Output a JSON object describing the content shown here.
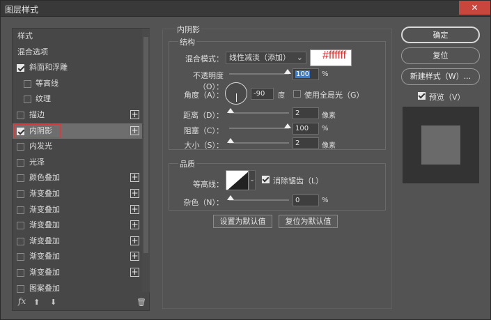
{
  "window": {
    "title": "图层样式",
    "close_glyph": "✕"
  },
  "left_panel": {
    "items": [
      {
        "label": "样式",
        "checkbox": null,
        "plus": false
      },
      {
        "label": "混合选项",
        "checkbox": null,
        "plus": false
      },
      {
        "label": "斜面和浮雕",
        "checkbox": true,
        "plus": false
      },
      {
        "label": "等高线",
        "checkbox": false,
        "plus": false,
        "indent": true
      },
      {
        "label": "纹理",
        "checkbox": false,
        "plus": false,
        "indent": true
      },
      {
        "label": "描边",
        "checkbox": false,
        "plus": true
      },
      {
        "label": "内阴影",
        "checkbox": true,
        "plus": true,
        "selected": true
      },
      {
        "label": "内发光",
        "checkbox": false,
        "plus": false
      },
      {
        "label": "光泽",
        "checkbox": false,
        "plus": false
      },
      {
        "label": "颜色叠加",
        "checkbox": false,
        "plus": true
      },
      {
        "label": "渐变叠加",
        "checkbox": false,
        "plus": true
      },
      {
        "label": "渐变叠加",
        "checkbox": false,
        "plus": true
      },
      {
        "label": "渐变叠加",
        "checkbox": false,
        "plus": true
      },
      {
        "label": "渐变叠加",
        "checkbox": false,
        "plus": true
      },
      {
        "label": "渐变叠加",
        "checkbox": false,
        "plus": true
      },
      {
        "label": "渐变叠加",
        "checkbox": false,
        "plus": true
      },
      {
        "label": "图案叠加",
        "checkbox": false,
        "plus": false
      }
    ],
    "footer": {
      "fx": "fx",
      "up": "⬆",
      "down": "⬇",
      "trash": "🗑"
    }
  },
  "inner_shadow": {
    "section_title": "内阴影",
    "structure": {
      "title": "结构",
      "blend_mode_label": "混合模式：",
      "blend_mode_value": "线性减淡（添加）",
      "color_hex_annotation": "#ffffff",
      "opacity_label": "不透明度（O）：",
      "opacity_value": "100",
      "opacity_unit": "%",
      "angle_label": "角度（A）：",
      "angle_value": "-90",
      "angle_unit": "度",
      "global_light_label": "使用全局光（G）",
      "global_light_checked": false,
      "distance_label": "距离（D）：",
      "distance_value": "2",
      "distance_unit": "像素",
      "choke_label": "阻塞（C）：",
      "choke_value": "100",
      "choke_unit": "%",
      "size_label": "大小（S）：",
      "size_value": "2",
      "size_unit": "像素"
    },
    "quality": {
      "title": "品质",
      "contour_label": "等高线：",
      "antialias_label": "消除锯齿（L）",
      "antialias_checked": true,
      "noise_label": "杂色（N）：",
      "noise_value": "0",
      "noise_unit": "%"
    },
    "buttons": {
      "set_default": "设置为默认值",
      "reset_default": "复位为默认值"
    }
  },
  "right_buttons": {
    "ok": "确定",
    "reset": "复位",
    "new_style": "新建样式（W）...",
    "preview_label": "预览（V）",
    "preview_checked": true
  },
  "colors": {
    "accent_highlight": "#3b7fd0",
    "annotation_red": "#e03030",
    "close": "#c9463d"
  }
}
